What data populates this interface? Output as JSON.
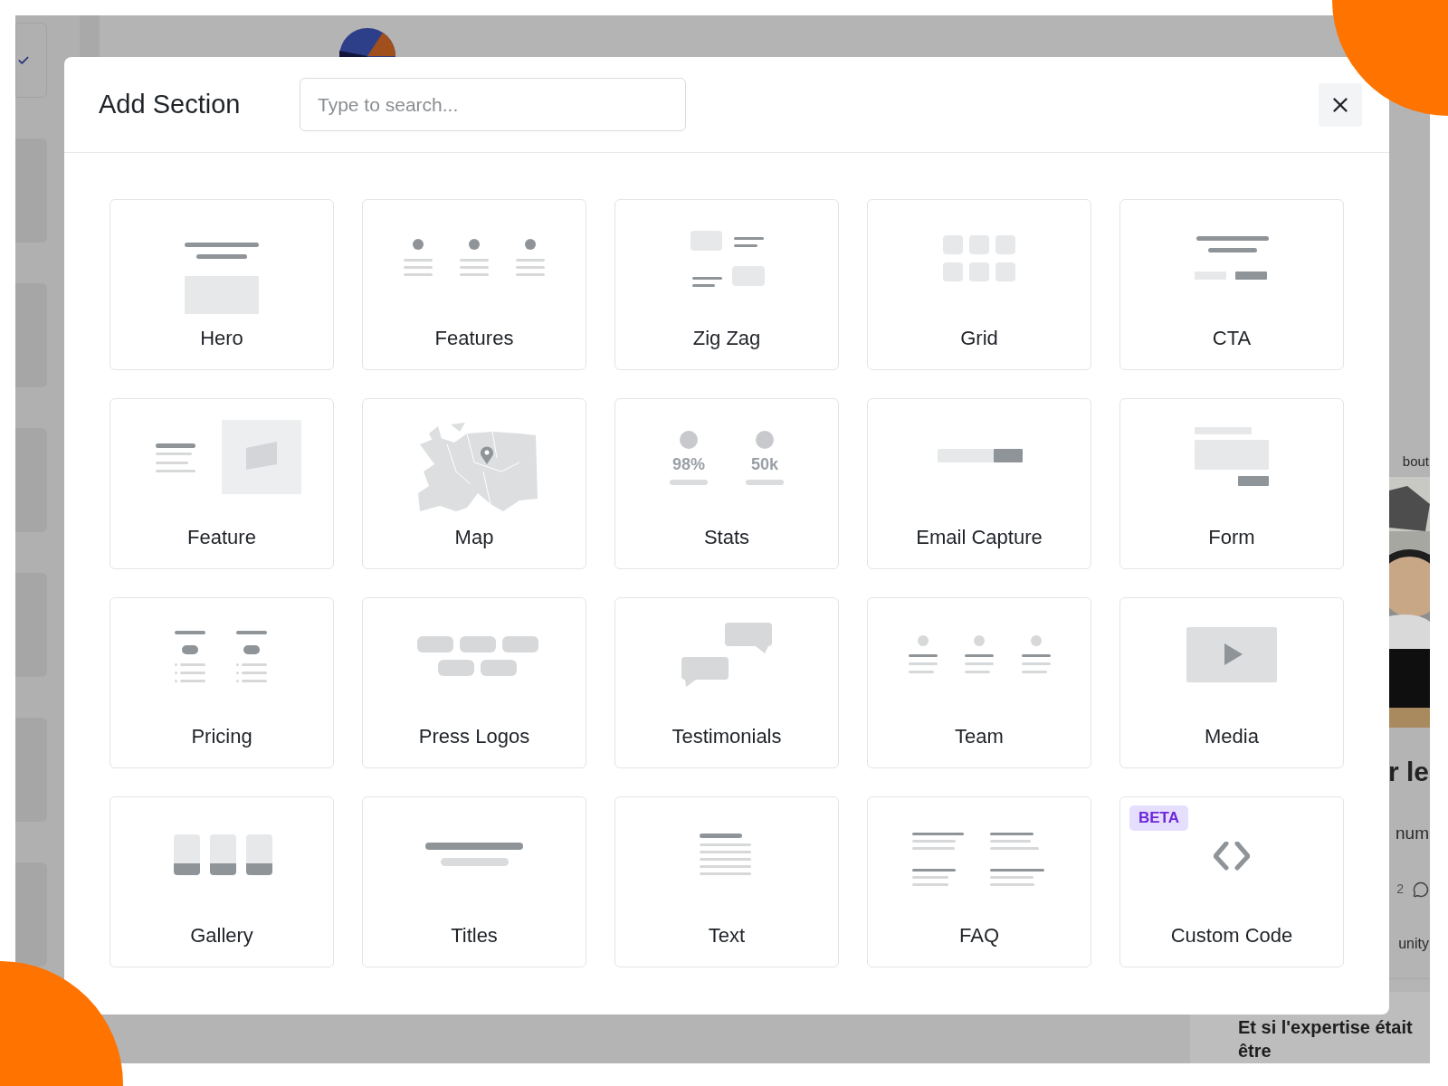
{
  "background": {
    "article": {
      "link": "bout",
      "heading": "r le",
      "excerpt": "num",
      "count": "2",
      "footer": "unity"
    },
    "promo_card": {
      "lines": [
        "Et si l'expertise était",
        "être"
      ]
    }
  },
  "modal": {
    "title": "Add Section",
    "search": {
      "placeholder": "Type to search..."
    },
    "sections": [
      {
        "label": "Hero"
      },
      {
        "label": "Features"
      },
      {
        "label": "Zig Zag"
      },
      {
        "label": "Grid"
      },
      {
        "label": "CTA"
      },
      {
        "label": "Feature"
      },
      {
        "label": "Map"
      },
      {
        "label": "Stats",
        "figures": [
          "98%",
          "50k"
        ]
      },
      {
        "label": "Email Capture"
      },
      {
        "label": "Form"
      },
      {
        "label": "Pricing"
      },
      {
        "label": "Press Logos"
      },
      {
        "label": "Testimonials"
      },
      {
        "label": "Team"
      },
      {
        "label": "Media"
      },
      {
        "label": "Gallery"
      },
      {
        "label": "Titles"
      },
      {
        "label": "Text"
      },
      {
        "label": "FAQ"
      },
      {
        "label": "Custom Code",
        "badge": "BETA"
      }
    ]
  }
}
